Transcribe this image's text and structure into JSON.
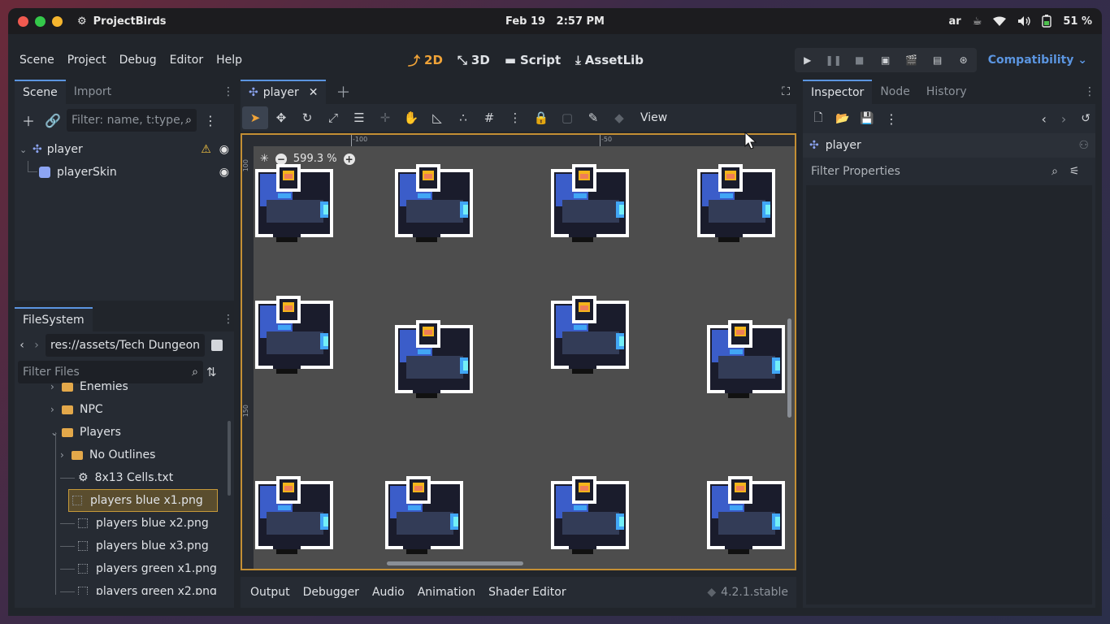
{
  "system": {
    "app_name": "ProjectBirds",
    "date": "Feb 19",
    "time": "2:57 PM",
    "keyboard": "ar",
    "battery": "51 %",
    "traffic_colors": [
      "#f05a50",
      "#34c84a",
      "#f5b52e"
    ]
  },
  "menu": [
    "Scene",
    "Project",
    "Debug",
    "Editor",
    "Help"
  ],
  "modes": [
    {
      "label": "2D",
      "icon": "2d-icon",
      "active": true
    },
    {
      "label": "3D",
      "icon": "3d-icon",
      "active": false
    },
    {
      "label": "Script",
      "icon": "script-icon",
      "active": false
    },
    {
      "label": "AssetLib",
      "icon": "assetlib-icon",
      "active": false
    }
  ],
  "renderer": "Compatibility",
  "scene_dock": {
    "tabs": [
      "Scene",
      "Import"
    ],
    "filter_placeholder": "Filter: name, t:type,",
    "nodes": [
      {
        "name": "player",
        "icon": "node2d-icon",
        "warning": true
      },
      {
        "name": "playerSkin",
        "icon": "sprite2d-icon",
        "warning": false
      }
    ]
  },
  "filesystem": {
    "tab": "FileSystem",
    "path": "res://assets/Tech Dungeon",
    "filter_placeholder": "Filter Files",
    "items": [
      {
        "label": "Enemies",
        "type": "folder"
      },
      {
        "label": "NPC",
        "type": "folder"
      },
      {
        "label": "Players",
        "type": "folder"
      },
      {
        "label": "No Outlines",
        "type": "folder"
      },
      {
        "label": "8x13 Cells.txt",
        "type": "text"
      },
      {
        "label": "players blue x1.png",
        "type": "image",
        "selected": true
      },
      {
        "label": "players blue x2.png",
        "type": "image"
      },
      {
        "label": "players blue x3.png",
        "type": "image"
      },
      {
        "label": "players green x1.png",
        "type": "image"
      },
      {
        "label": "players green x2.png",
        "type": "image"
      }
    ]
  },
  "editor": {
    "scene_tab": "player",
    "view_menu": "View",
    "zoom": "599.3 %",
    "ruler_top": [
      "-100",
      "-50"
    ],
    "ruler_left": [
      "100",
      "150"
    ]
  },
  "bottom_panel": {
    "tabs": [
      "Output",
      "Debugger",
      "Audio",
      "Animation",
      "Shader Editor"
    ],
    "version": "4.2.1.stable"
  },
  "inspector": {
    "tabs": [
      "Inspector",
      "Node",
      "History"
    ],
    "object": "player",
    "filter_placeholder": "Filter Properties"
  },
  "colors": {
    "accent": "#5b95e0",
    "active_tool": "#f0a338",
    "viewport_border": "#c48f34",
    "warning": "#f5c542"
  }
}
